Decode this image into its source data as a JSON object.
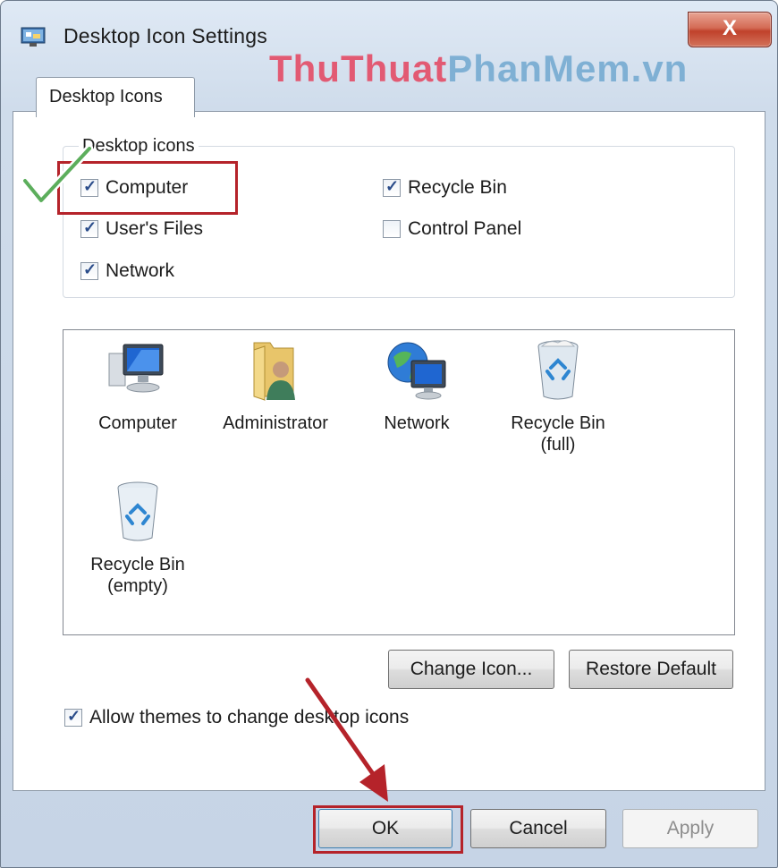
{
  "window": {
    "title": "Desktop Icon Settings",
    "close_label": "X"
  },
  "watermark": {
    "part1": "ThuThuat",
    "part2": "PhanMem.vn"
  },
  "tabs": [
    {
      "label": "Desktop Icons"
    }
  ],
  "group": {
    "label": "Desktop icons",
    "items": [
      {
        "label": "Computer",
        "checked": true
      },
      {
        "label": "Recycle Bin",
        "checked": true
      },
      {
        "label": "User's Files",
        "checked": true
      },
      {
        "label": "Control Panel",
        "checked": false
      },
      {
        "label": "Network",
        "checked": true
      }
    ]
  },
  "icons": [
    {
      "label": "Computer",
      "icon": "computer-icon"
    },
    {
      "label": "Administrator",
      "icon": "user-folder-icon"
    },
    {
      "label": "Network",
      "icon": "network-globe-icon"
    },
    {
      "label": "Recycle Bin\n(full)",
      "line1": "Recycle Bin",
      "line2": "(full)",
      "icon": "recycle-bin-full-icon"
    },
    {
      "label": "Recycle Bin\n(empty)",
      "line1": "Recycle Bin",
      "line2": "(empty)",
      "icon": "recycle-bin-empty-icon"
    }
  ],
  "buttons": {
    "change_icon": "Change Icon...",
    "restore_default": "Restore Default",
    "ok": "OK",
    "cancel": "Cancel",
    "apply": "Apply"
  },
  "allow_themes": {
    "label": "Allow themes to change desktop icons",
    "checked": true
  },
  "colors": {
    "highlight": "#b5232a",
    "check_green": "#4caf50"
  }
}
